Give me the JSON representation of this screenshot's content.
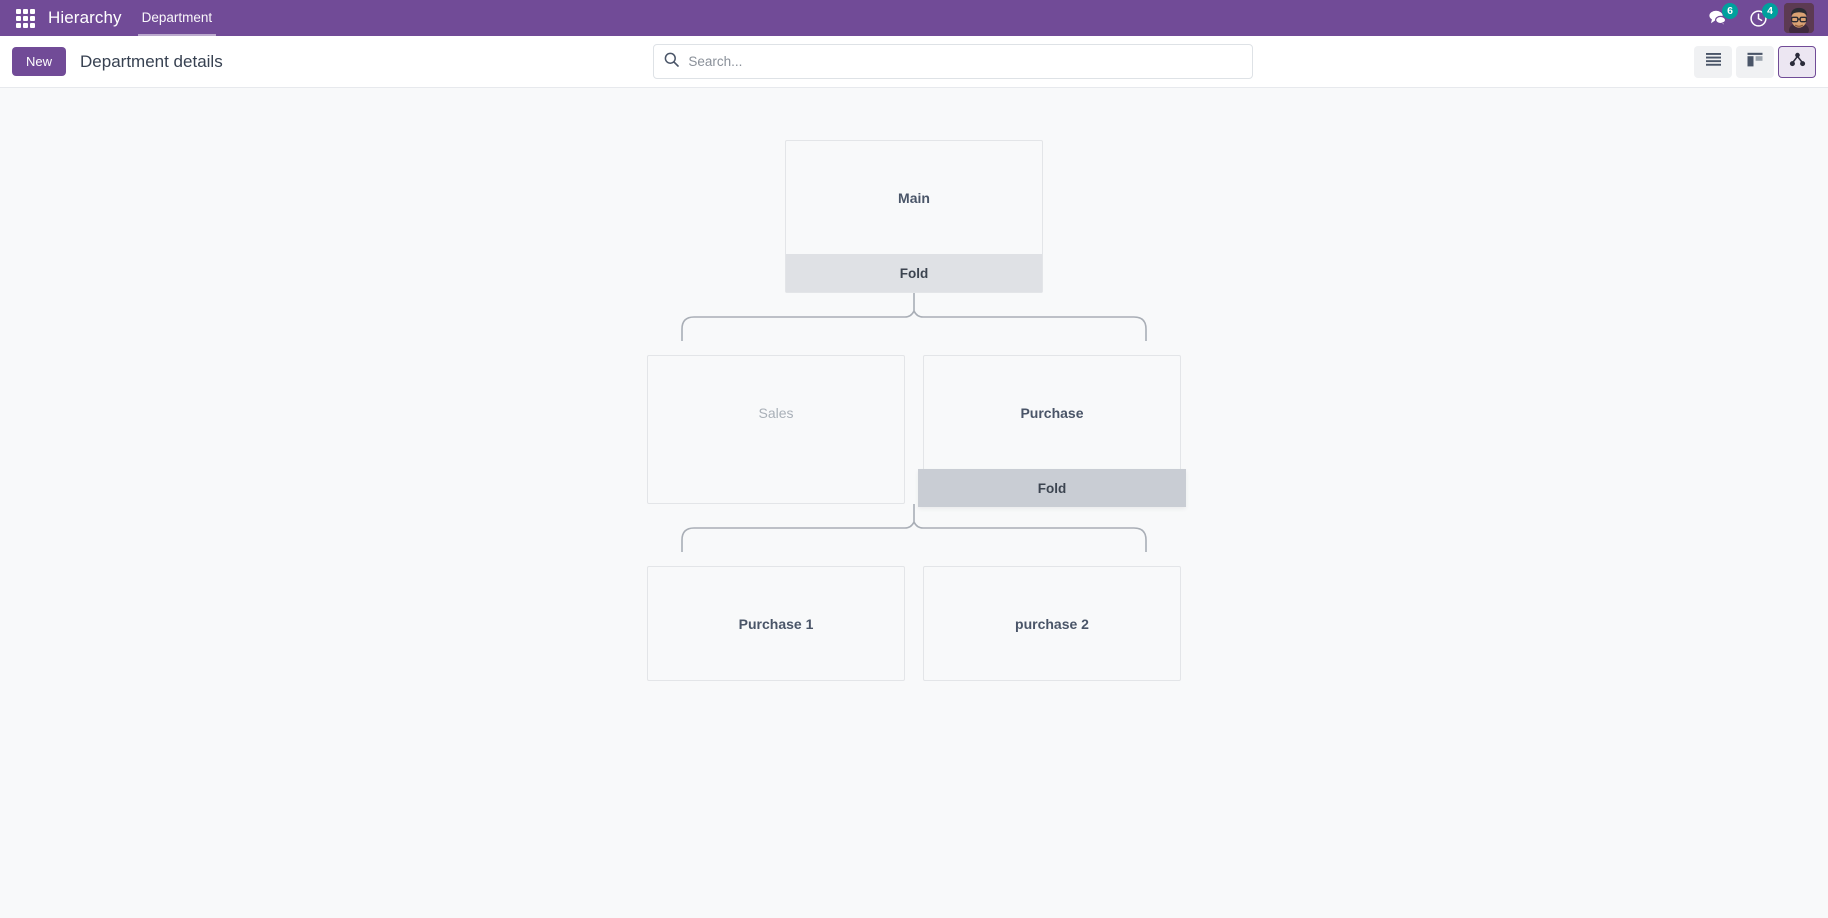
{
  "navbar": {
    "apps_icon": "apps-grid-icon",
    "brand": "Hierarchy",
    "menus": [
      {
        "label": "Department",
        "active": true
      }
    ],
    "messages": {
      "icon": "chat-bubble-icon",
      "count": "6"
    },
    "activities": {
      "icon": "clock-icon",
      "count": "4"
    },
    "avatar_alt": "user-avatar",
    "brand_color": "#714B97",
    "badge_color": "#00A09D"
  },
  "control_panel": {
    "new_label": "New",
    "title": "Department details",
    "search": {
      "icon": "search-icon",
      "placeholder": "Search...",
      "value": ""
    },
    "views": [
      {
        "name": "list",
        "icon": "list-view-icon",
        "active": false
      },
      {
        "name": "kanban",
        "icon": "kanban-view-icon",
        "active": false
      },
      {
        "name": "hierarchy",
        "icon": "hierarchy-view-icon",
        "active": true
      }
    ]
  },
  "hierarchy": {
    "levels": [
      {
        "nodes": [
          {
            "name": "Main",
            "muted": false,
            "fold_label": "Fold",
            "fold_hovered": false
          }
        ]
      },
      {
        "nodes": [
          {
            "name": "Sales",
            "muted": true,
            "fold_label": null,
            "fold_hovered": false
          },
          {
            "name": "Purchase",
            "muted": false,
            "fold_label": "Fold",
            "fold_hovered": true
          }
        ]
      },
      {
        "nodes": [
          {
            "name": "Purchase 1",
            "muted": false,
            "fold_label": null,
            "fold_hovered": false
          },
          {
            "name": "purchase 2",
            "muted": false,
            "fold_label": null,
            "fold_hovered": false
          }
        ]
      }
    ]
  }
}
